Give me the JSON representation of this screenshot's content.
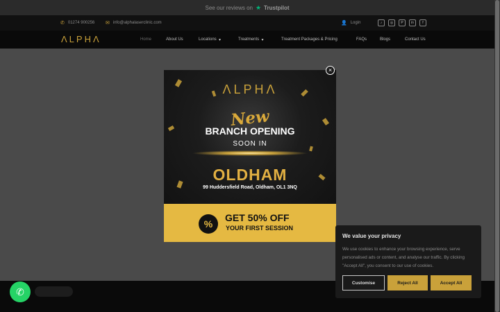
{
  "reviews_bar": {
    "text": "See our reviews on",
    "brand": "Trustpilot"
  },
  "contact": {
    "phone": "01274 900256",
    "email": "info@alphalaserclinic.com",
    "login": "Login"
  },
  "social_icons": [
    "tiktok-icon",
    "instagram-icon",
    "pinterest-icon",
    "linkedin-icon",
    "facebook-icon"
  ],
  "nav": {
    "logo": "ΛLPHΛ",
    "items": [
      "Home",
      "About Us",
      "Locations",
      "Treatments",
      "Treatment Packages & Pricing",
      "FAQs",
      "Blogs",
      "Contact Us"
    ],
    "dropdown_arrow": "▾"
  },
  "popup": {
    "logo": "ΛLPHΛ",
    "new": "New",
    "headline": "BRANCH OPENING",
    "soon": "SOON IN",
    "city": "OLDHAM",
    "address": "99 Huddersfield Road, Oldham, OL1 3NQ",
    "offer_line1": "GET 50% OFF",
    "offer_line2": "YOUR FIRST SESSION",
    "percent_symbol": "%",
    "close_symbol": "×"
  },
  "cookie": {
    "title": "We value your privacy",
    "text": "We use cookies to enhance your browsing experience, serve personalised ads or content, and analyse our traffic. By clicking \"Accept All\", you consent to our use of cookies.",
    "customise": "Customise",
    "reject": "Reject All",
    "accept": "Accept All"
  },
  "colors": {
    "gold": "#c9a13a",
    "whatsapp": "#25d366",
    "trustpilot": "#00b67a"
  }
}
